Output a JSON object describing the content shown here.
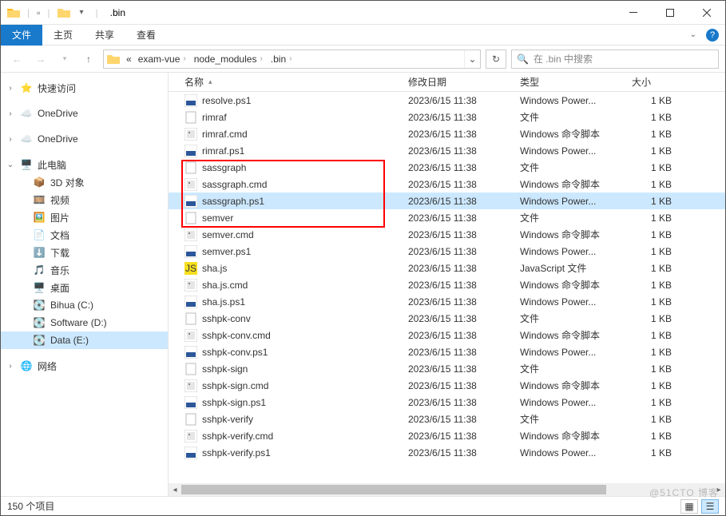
{
  "title": ".bin",
  "tabs": {
    "file": "文件",
    "home": "主页",
    "share": "共享",
    "view": "查看"
  },
  "breadcrumb": {
    "root_chevron": "«",
    "seg1": "exam-vue",
    "seg2": "node_modules",
    "seg3": ".bin"
  },
  "search": {
    "placeholder": "在 .bin 中搜索",
    "icon": "🔍"
  },
  "sidebar": {
    "quick": "快速访问",
    "onedrive1": "OneDrive",
    "onedrive2": "OneDrive",
    "thispc": "此电脑",
    "pc_items": [
      {
        "label": "3D 对象"
      },
      {
        "label": "视频"
      },
      {
        "label": "图片"
      },
      {
        "label": "文档"
      },
      {
        "label": "下载"
      },
      {
        "label": "音乐"
      },
      {
        "label": "桌面"
      },
      {
        "label": "Bihua (C:)"
      },
      {
        "label": "Software (D:)"
      },
      {
        "label": "Data (E:)"
      }
    ],
    "network": "网络"
  },
  "columns": {
    "name": "名称",
    "date": "修改日期",
    "type": "类型",
    "size": "大小"
  },
  "files": [
    {
      "name": "resolve.ps1",
      "date": "2023/6/15 11:38",
      "type": "Windows Power...",
      "size": "1 KB",
      "icon": "ps1"
    },
    {
      "name": "rimraf",
      "date": "2023/6/15 11:38",
      "type": "文件",
      "size": "1 KB",
      "icon": "file"
    },
    {
      "name": "rimraf.cmd",
      "date": "2023/6/15 11:38",
      "type": "Windows 命令脚本",
      "size": "1 KB",
      "icon": "cmd"
    },
    {
      "name": "rimraf.ps1",
      "date": "2023/6/15 11:38",
      "type": "Windows Power...",
      "size": "1 KB",
      "icon": "ps1"
    },
    {
      "name": "sassgraph",
      "date": "2023/6/15 11:38",
      "type": "文件",
      "size": "1 KB",
      "icon": "file"
    },
    {
      "name": "sassgraph.cmd",
      "date": "2023/6/15 11:38",
      "type": "Windows 命令脚本",
      "size": "1 KB",
      "icon": "cmd"
    },
    {
      "name": "sassgraph.ps1",
      "date": "2023/6/15 11:38",
      "type": "Windows Power...",
      "size": "1 KB",
      "icon": "ps1",
      "selected": true
    },
    {
      "name": "semver",
      "date": "2023/6/15 11:38",
      "type": "文件",
      "size": "1 KB",
      "icon": "file"
    },
    {
      "name": "semver.cmd",
      "date": "2023/6/15 11:38",
      "type": "Windows 命令脚本",
      "size": "1 KB",
      "icon": "cmd"
    },
    {
      "name": "semver.ps1",
      "date": "2023/6/15 11:38",
      "type": "Windows Power...",
      "size": "1 KB",
      "icon": "ps1"
    },
    {
      "name": "sha.js",
      "date": "2023/6/15 11:38",
      "type": "JavaScript 文件",
      "size": "1 KB",
      "icon": "js"
    },
    {
      "name": "sha.js.cmd",
      "date": "2023/6/15 11:38",
      "type": "Windows 命令脚本",
      "size": "1 KB",
      "icon": "cmd"
    },
    {
      "name": "sha.js.ps1",
      "date": "2023/6/15 11:38",
      "type": "Windows Power...",
      "size": "1 KB",
      "icon": "ps1"
    },
    {
      "name": "sshpk-conv",
      "date": "2023/6/15 11:38",
      "type": "文件",
      "size": "1 KB",
      "icon": "file"
    },
    {
      "name": "sshpk-conv.cmd",
      "date": "2023/6/15 11:38",
      "type": "Windows 命令脚本",
      "size": "1 KB",
      "icon": "cmd"
    },
    {
      "name": "sshpk-conv.ps1",
      "date": "2023/6/15 11:38",
      "type": "Windows Power...",
      "size": "1 KB",
      "icon": "ps1"
    },
    {
      "name": "sshpk-sign",
      "date": "2023/6/15 11:38",
      "type": "文件",
      "size": "1 KB",
      "icon": "file"
    },
    {
      "name": "sshpk-sign.cmd",
      "date": "2023/6/15 11:38",
      "type": "Windows 命令脚本",
      "size": "1 KB",
      "icon": "cmd"
    },
    {
      "name": "sshpk-sign.ps1",
      "date": "2023/6/15 11:38",
      "type": "Windows Power...",
      "size": "1 KB",
      "icon": "ps1"
    },
    {
      "name": "sshpk-verify",
      "date": "2023/6/15 11:38",
      "type": "文件",
      "size": "1 KB",
      "icon": "file"
    },
    {
      "name": "sshpk-verify.cmd",
      "date": "2023/6/15 11:38",
      "type": "Windows 命令脚本",
      "size": "1 KB",
      "icon": "cmd"
    },
    {
      "name": "sshpk-verify.ps1",
      "date": "2023/6/15 11:38",
      "type": "Windows Power...",
      "size": "1 KB",
      "icon": "ps1"
    }
  ],
  "status": {
    "items": "150 个项目"
  },
  "watermark": "@51CTO 博客"
}
